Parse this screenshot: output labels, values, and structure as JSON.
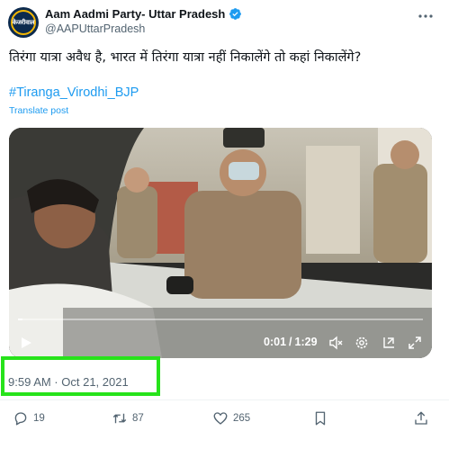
{
  "author": {
    "avatar_text": "केजरीवाल",
    "display_name": "Aam Aadmi Party- Uttar Pradesh",
    "handle": "@AAPUttarPradesh",
    "verified_color": "#1d9bf0"
  },
  "tweet": {
    "text": "तिरंगा यात्रा अवैध है, भारत में तिरंगा यात्रा नहीं निकालेंगे तो कहां निकालेंगे?",
    "hashtag": "#Tiranga_Virodhi_BJP",
    "translate_label": "Translate post",
    "timestamp": "9:59 AM · Oct 21, 2021"
  },
  "video": {
    "current_time": "0:01",
    "duration": "1:29",
    "progress_fraction": 0.011
  },
  "actions": {
    "replies": "19",
    "reposts": "87",
    "likes": "265"
  },
  "colors": {
    "accent": "#1d9bf0",
    "highlight_box": "#27e31b",
    "muted_text": "#536471"
  }
}
